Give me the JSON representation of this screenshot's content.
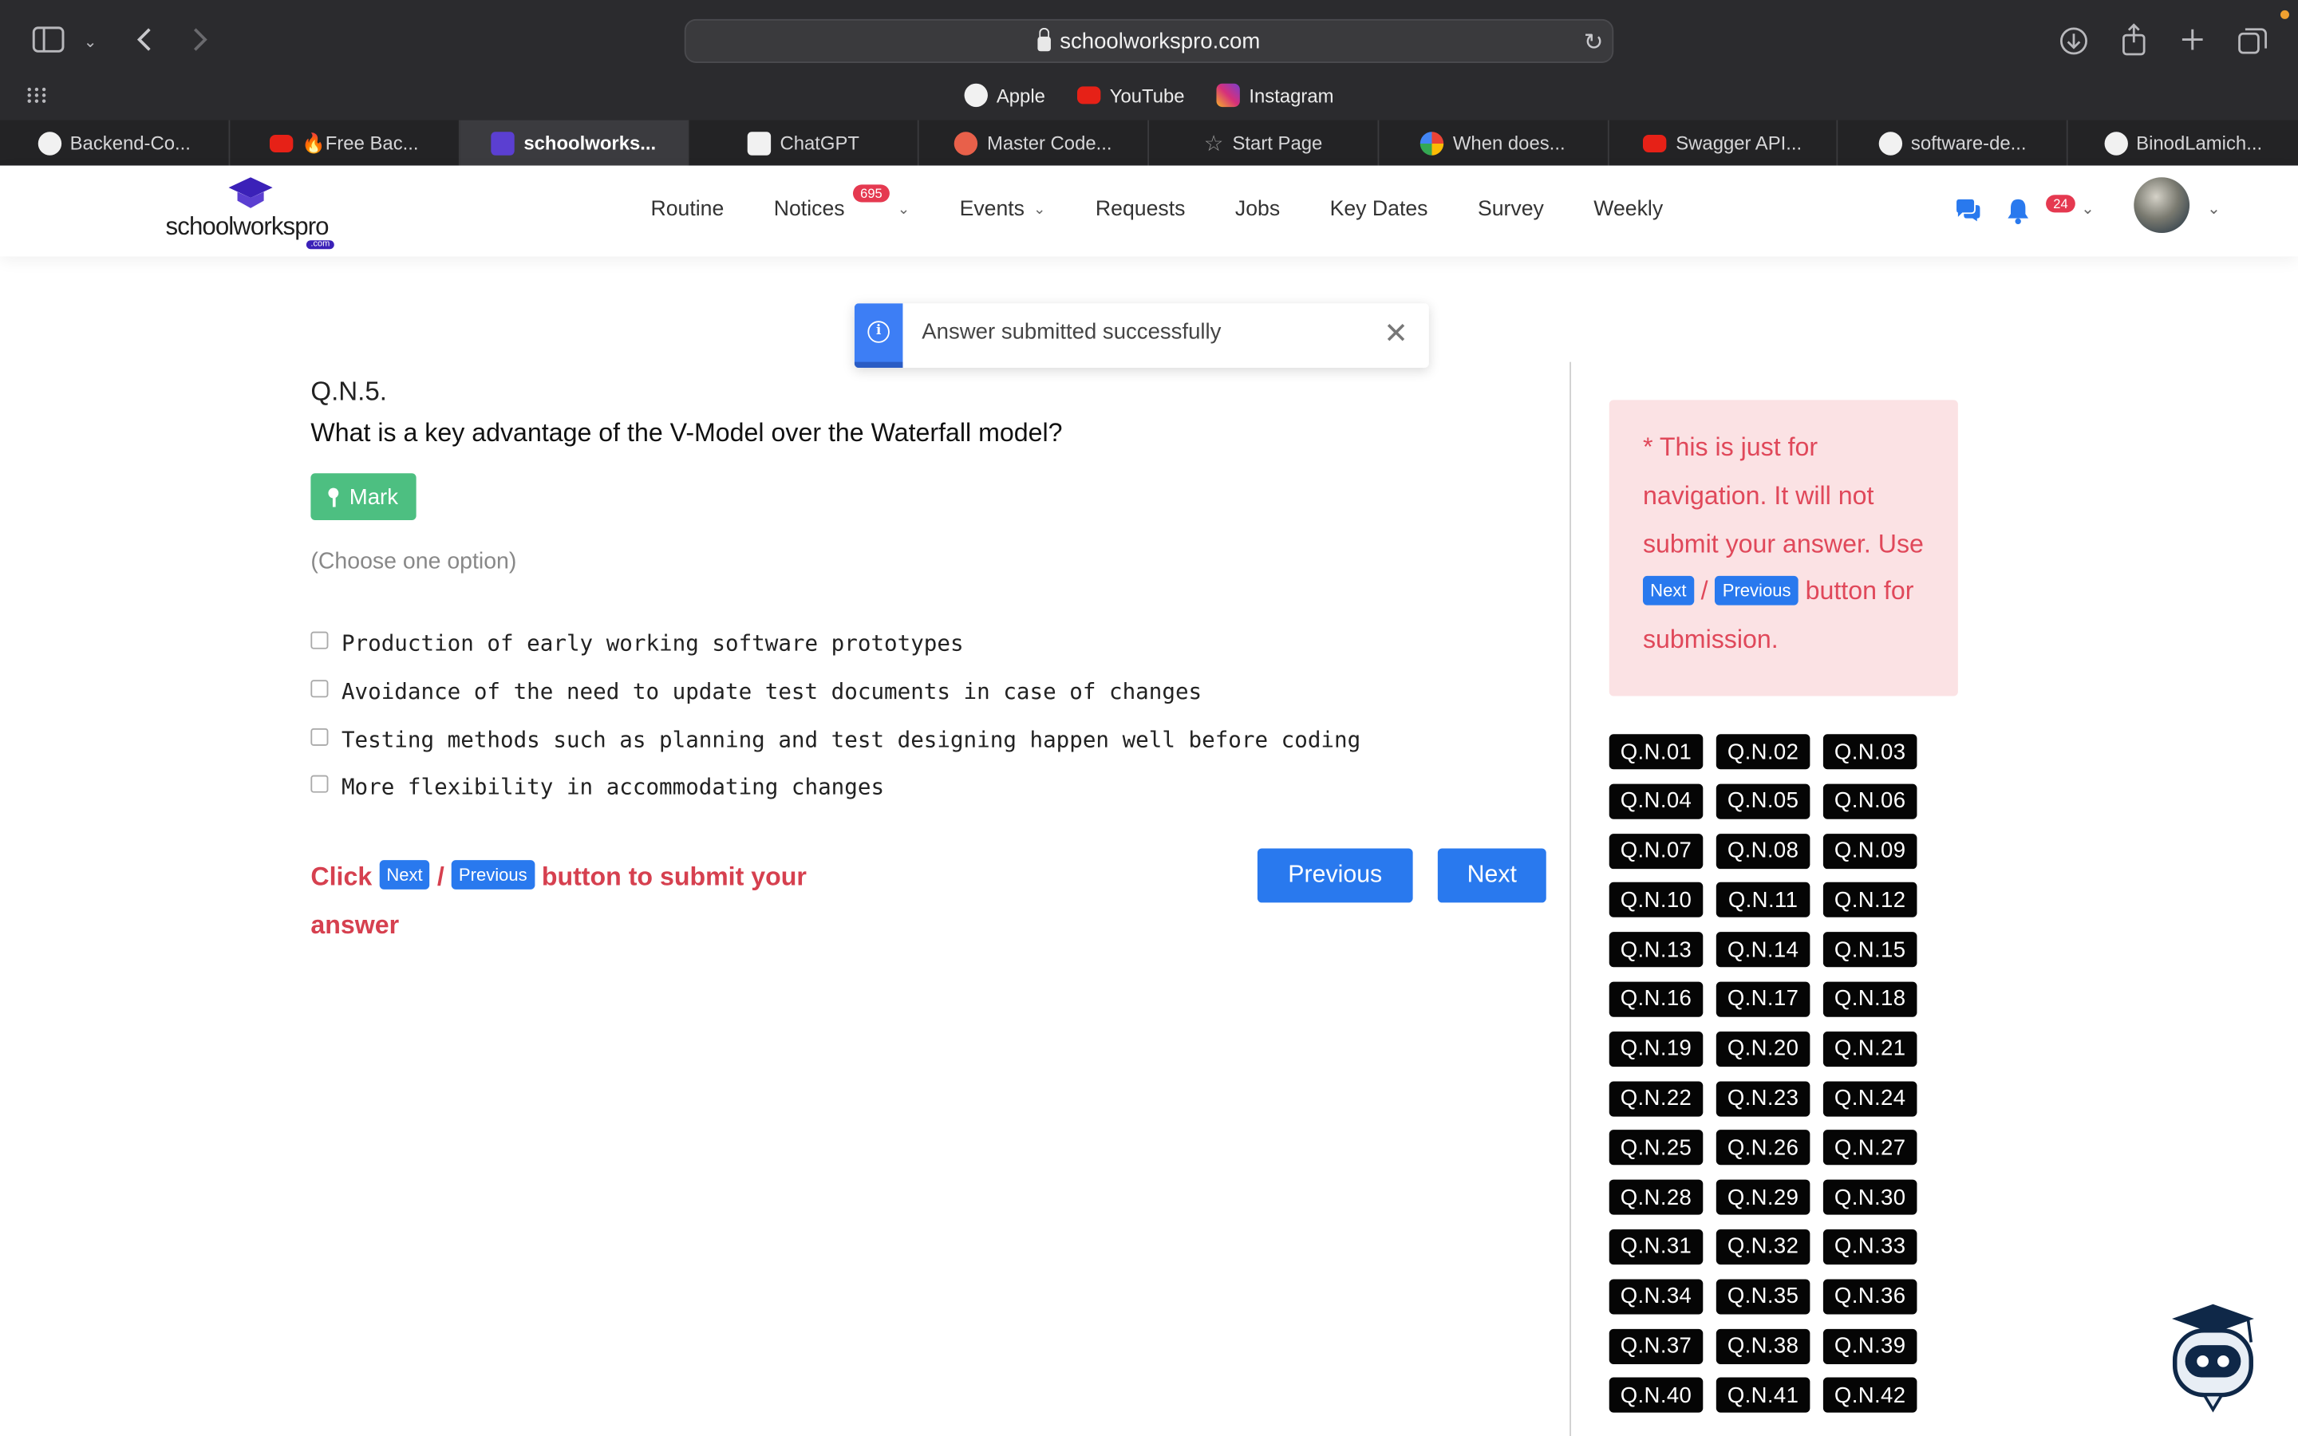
{
  "browser": {
    "url": "schoolworkspro.com",
    "favorites": [
      {
        "label": "Apple",
        "icon": "apple-icon",
        "color": "#f1f1f1"
      },
      {
        "label": "YouTube",
        "icon": "youtube-icon",
        "color": "#e62117"
      },
      {
        "label": "Instagram",
        "icon": "instagram-icon",
        "color": "#d6307a"
      }
    ],
    "tabs": [
      {
        "label": "Backend-Co...",
        "icon": "github-icon",
        "color": "#f1f1f1",
        "active": false
      },
      {
        "label": "🔥Free Bac...",
        "icon": "youtube-icon",
        "color": "#e62117",
        "active": false
      },
      {
        "label": "schoolworks...",
        "icon": "schoolworkspro-icon",
        "color": "#5b3fd1",
        "active": true
      },
      {
        "label": "ChatGPT",
        "icon": "chatgpt-icon",
        "color": "#f1f1f1",
        "active": false
      },
      {
        "label": "Master Code...",
        "icon": "mastercode-icon",
        "color": "#e8604a",
        "active": false
      },
      {
        "label": "Start Page",
        "icon": "star-icon",
        "color": "#9a9a9a",
        "active": false
      },
      {
        "label": "When does...",
        "icon": "google-icon",
        "color": "#4285f4",
        "active": false
      },
      {
        "label": "Swagger API...",
        "icon": "youtube-icon",
        "color": "#e62117",
        "active": false
      },
      {
        "label": "software-de...",
        "icon": "github-icon",
        "color": "#f1f1f1",
        "active": false
      },
      {
        "label": "BinodLamich...",
        "icon": "github-icon",
        "color": "#f1f1f1",
        "active": false
      }
    ]
  },
  "header": {
    "logo_text": "schoolworkspro",
    "logo_suffix": ".com",
    "nav": [
      {
        "label": "Routine",
        "dropdown": false
      },
      {
        "label": "Notices",
        "badge": "695",
        "dropdown": true
      },
      {
        "label": "Events",
        "dropdown": true
      },
      {
        "label": "Requests",
        "dropdown": false
      },
      {
        "label": "Jobs",
        "dropdown": false
      },
      {
        "label": "Key Dates",
        "dropdown": false
      },
      {
        "label": "Survey",
        "dropdown": false
      },
      {
        "label": "Weekly",
        "dropdown": false
      }
    ],
    "notification_badge": "24",
    "accent": "#2979ee",
    "badge_color": "#e53950"
  },
  "toast": {
    "message": "Answer submitted successfully",
    "close": "✕"
  },
  "question": {
    "number": "Q.N.5.",
    "text": "What is a key advantage of the V-Model over the Waterfall model?",
    "mark_label": "Mark",
    "hint": "(Choose one option)",
    "options": [
      "Production of early working software prototypes",
      "Avoidance of the need to update test documents in case of changes",
      "Testing methods such as planning and test designing happen well before coding",
      "More flexibility in accommodating changes"
    ],
    "submit_note": {
      "prefix": "Click",
      "next": "Next",
      "slash": "/",
      "previous": "Previous",
      "suffix": "button to submit your answer"
    },
    "previous_button": "Previous",
    "next_button": "Next"
  },
  "sidebar": {
    "note": {
      "line1": "* This is just for navigation. It will not submit your answer.",
      "use": "Use",
      "next": "Next",
      "slash": "/",
      "previous": "Previous",
      "line2": "button for submission."
    },
    "questions": [
      "Q.N.01",
      "Q.N.02",
      "Q.N.03",
      "Q.N.04",
      "Q.N.05",
      "Q.N.06",
      "Q.N.07",
      "Q.N.08",
      "Q.N.09",
      "Q.N.10",
      "Q.N.11",
      "Q.N.12",
      "Q.N.13",
      "Q.N.14",
      "Q.N.15",
      "Q.N.16",
      "Q.N.17",
      "Q.N.18",
      "Q.N.19",
      "Q.N.20",
      "Q.N.21",
      "Q.N.22",
      "Q.N.23",
      "Q.N.24",
      "Q.N.25",
      "Q.N.26",
      "Q.N.27",
      "Q.N.28",
      "Q.N.29",
      "Q.N.30",
      "Q.N.31",
      "Q.N.32",
      "Q.N.33",
      "Q.N.34",
      "Q.N.35",
      "Q.N.36",
      "Q.N.37",
      "Q.N.38",
      "Q.N.39",
      "Q.N.40",
      "Q.N.41",
      "Q.N.42"
    ]
  }
}
